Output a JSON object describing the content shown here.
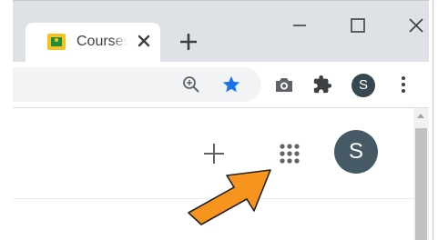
{
  "tab": {
    "title": "Courses",
    "favicon": "google-classroom-icon"
  },
  "window_controls": [
    "minimize-icon",
    "maximize-icon",
    "close-icon"
  ],
  "toolbar": {
    "icons": [
      "zoom-icon",
      "bookmark-star-icon",
      "camera-icon",
      "extensions-puzzle-icon",
      "profile-avatar",
      "more-menu-icon"
    ],
    "profile_initial": "S"
  },
  "page": {
    "add_icon": "plus-icon",
    "apps_icon": "google-apps-grid-icon",
    "account_initial": "S"
  },
  "annotation": {
    "type": "arrow",
    "color": "#f7941d",
    "points_to": "google-apps-grid-icon"
  },
  "colors": {
    "titlebar": "#dee1e6",
    "star_blue": "#1a73e8",
    "avatar": "#455a64",
    "arrow": "#f7941d"
  }
}
